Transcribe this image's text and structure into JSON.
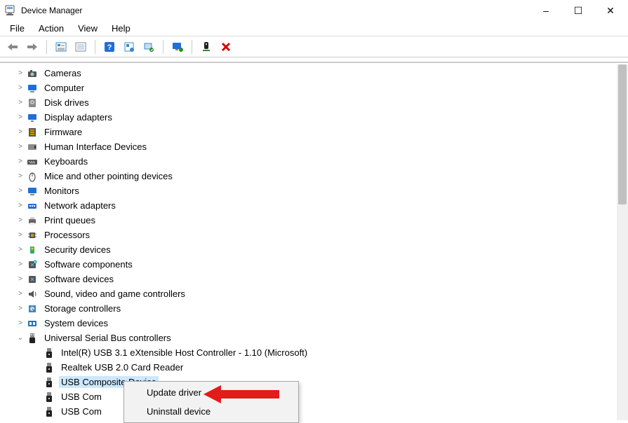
{
  "window": {
    "title": "Device Manager",
    "controls": {
      "minimize": "–",
      "maximize": "☐",
      "close": "✕"
    }
  },
  "menu": [
    "File",
    "Action",
    "View",
    "Help"
  ],
  "toolbar": {
    "back": "back-arrow",
    "forward": "forward-arrow",
    "props_window": "props",
    "refresh": "refresh",
    "help": "help",
    "update": "update",
    "scan": "scan",
    "monitor": "monitor",
    "usb_eject": "eject",
    "remove": "remove"
  },
  "tree": {
    "categories": [
      {
        "icon": "camera",
        "label": "Cameras"
      },
      {
        "icon": "computer",
        "label": "Computer"
      },
      {
        "icon": "disk",
        "label": "Disk drives"
      },
      {
        "icon": "display",
        "label": "Display adapters"
      },
      {
        "icon": "firmware",
        "label": "Firmware"
      },
      {
        "icon": "hid",
        "label": "Human Interface Devices"
      },
      {
        "icon": "keyboard",
        "label": "Keyboards"
      },
      {
        "icon": "mouse",
        "label": "Mice and other pointing devices"
      },
      {
        "icon": "monitor",
        "label": "Monitors"
      },
      {
        "icon": "network",
        "label": "Network adapters"
      },
      {
        "icon": "printer",
        "label": "Print queues"
      },
      {
        "icon": "cpu",
        "label": "Processors"
      },
      {
        "icon": "security",
        "label": "Security devices"
      },
      {
        "icon": "software",
        "label": "Software components"
      },
      {
        "icon": "softdev",
        "label": "Software devices"
      },
      {
        "icon": "sound",
        "label": "Sound, video and game controllers"
      },
      {
        "icon": "storage",
        "label": "Storage controllers"
      },
      {
        "icon": "system",
        "label": "System devices"
      }
    ],
    "expanded": {
      "icon": "usb",
      "label": "Universal Serial Bus controllers",
      "children": [
        {
          "label": "Intel(R) USB 3.1 eXtensible Host Controller - 1.10 (Microsoft)"
        },
        {
          "label": "Realtek USB 2.0 Card Reader"
        },
        {
          "label": "USB Composite Device",
          "selected": true
        },
        {
          "label": "USB Com"
        },
        {
          "label": "USB Com"
        }
      ]
    }
  },
  "context_menu": {
    "items": [
      "Update driver",
      "Uninstall device"
    ]
  }
}
